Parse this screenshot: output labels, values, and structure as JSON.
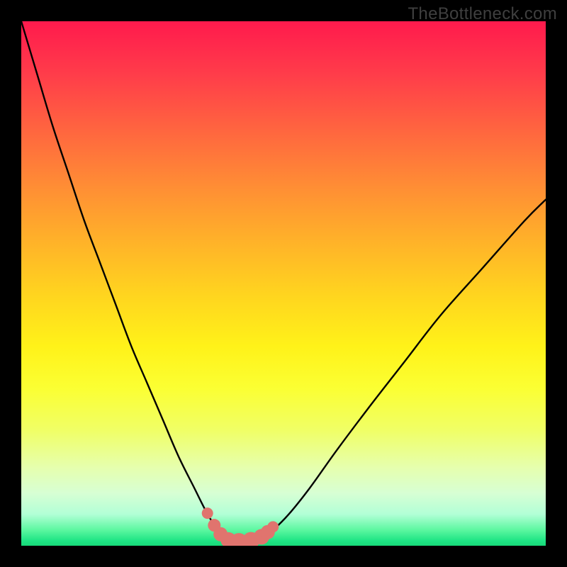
{
  "watermark": "TheBottleneck.com",
  "colors": {
    "frame": "#000000",
    "curve_stroke": "#000000",
    "marker_fill": "#e0746e",
    "marker_stroke": "#d86560"
  },
  "chart_data": {
    "type": "line",
    "title": "",
    "xlabel": "",
    "ylabel": "",
    "xlim": [
      0,
      100
    ],
    "ylim": [
      0,
      100
    ],
    "grid": false,
    "legend": false,
    "note": "No axis ticks or numeric labels are rendered; values are relative (0–100) in plot-area coordinates. y=100 is top (worst), y≈0 is bottom (best). Curve is a V-shaped bottleneck profile with a flat minimum around x≈38–46.",
    "series": [
      {
        "name": "bottleneck-curve",
        "x": [
          0,
          3,
          6,
          9,
          12,
          15,
          18,
          21,
          24,
          27,
          30,
          33,
          35,
          37,
          38,
          40,
          42,
          44,
          46,
          48,
          51,
          55,
          60,
          66,
          73,
          80,
          88,
          96,
          100
        ],
        "y": [
          100,
          90,
          80,
          71,
          62,
          54,
          46,
          38,
          31,
          24,
          17,
          11,
          7,
          3.5,
          1.8,
          1.0,
          0.8,
          1.0,
          1.6,
          3.0,
          6,
          11,
          18,
          26,
          35,
          44,
          53,
          62,
          66
        ]
      }
    ],
    "markers": {
      "name": "optimal-region-dots",
      "x": [
        35.5,
        36.8,
        38.0,
        39.5,
        41.5,
        43.8,
        45.8,
        47.0,
        48.0
      ],
      "y": [
        6.2,
        3.9,
        2.2,
        1.1,
        0.8,
        1.0,
        1.7,
        2.6,
        3.6
      ],
      "size": [
        8,
        9,
        10,
        11,
        12,
        12,
        11,
        10,
        8
      ]
    }
  }
}
